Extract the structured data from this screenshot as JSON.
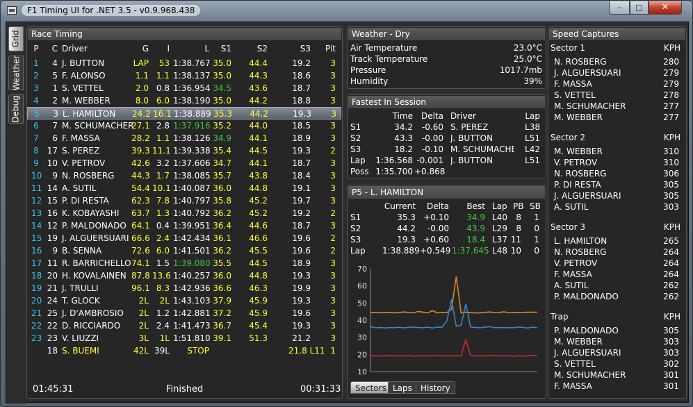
{
  "window": {
    "title": "F1 Timing UI for .NET 3.5 - v0.9.968.438",
    "min": "–",
    "max": "□",
    "close": "✕"
  },
  "side_tabs": [
    "Grid",
    "Weather",
    "Debug"
  ],
  "race": {
    "title": "Race Timing",
    "headers": [
      "P",
      "C",
      "Driver",
      "G",
      "I",
      "L",
      "S1",
      "S2",
      "S3",
      "Pit"
    ],
    "rows": [
      {
        "p": "1",
        "c": "4",
        "d": "J. BUTTON",
        "g": "LAP",
        "i": "53",
        "l": "1:38.767",
        "s1": "35.0",
        "s2": "44.4",
        "s3": "19.2",
        "pit": "3",
        "cols": {
          "p": "cyan",
          "d": "wht",
          "g": "yel",
          "i": "yel",
          "l": "wht",
          "s1": "yel",
          "s2": "yel",
          "s3": "wht",
          "pit": "yel"
        }
      },
      {
        "p": "2",
        "c": "5",
        "d": "F. ALONSO",
        "g": "1.1",
        "i": "1.1",
        "l": "1:38.137",
        "s1": "35.0",
        "s2": "44.3",
        "s3": "18.6",
        "pit": "3",
        "cols": {
          "p": "cyan",
          "d": "wht",
          "g": "yel",
          "i": "yel",
          "l": "wht",
          "s1": "yel",
          "s2": "yel",
          "s3": "wht",
          "pit": "yel"
        }
      },
      {
        "p": "3",
        "c": "1",
        "d": "S. VETTEL",
        "g": "2.0",
        "i": "0.8",
        "l": "1:36.954",
        "s1": "34.5",
        "s2": "43.6",
        "s3": "18.7",
        "pit": "3",
        "cols": {
          "p": "cyan",
          "d": "wht",
          "g": "yel",
          "i": "wht",
          "l": "wht",
          "s1": "grn",
          "s2": "yel",
          "s3": "wht",
          "pit": "yel"
        }
      },
      {
        "p": "4",
        "c": "2",
        "d": "M. WEBBER",
        "g": "8.0",
        "i": "6.0",
        "l": "1:38.190",
        "s1": "35.0",
        "s2": "44.2",
        "s3": "18.8",
        "pit": "3",
        "cols": {
          "p": "cyan",
          "d": "wht",
          "g": "yel",
          "i": "yel",
          "l": "wht",
          "s1": "yel",
          "s2": "yel",
          "s3": "wht",
          "pit": "yel"
        }
      },
      {
        "p": "5",
        "c": "3",
        "d": "L. HAMILTON",
        "g": "24.2",
        "i": "16.1",
        "l": "1:38.889",
        "s1": "35.3",
        "s2": "44.2",
        "s3": "19.3",
        "pit": "3",
        "sel": true,
        "cols": {
          "p": "cyan",
          "d": "wht",
          "g": "yel",
          "i": "yel",
          "l": "wht",
          "s1": "yel",
          "s2": "yel",
          "s3": "wht",
          "pit": "yel"
        }
      },
      {
        "p": "6",
        "c": "7",
        "d": "M. SCHUMACHER",
        "g": "27.1",
        "i": "2.8",
        "l": "1:37.916",
        "s1": "35.2",
        "s2": "44.0",
        "s3": "18.5",
        "pit": "3",
        "cols": {
          "p": "cyan",
          "d": "wht",
          "g": "yel",
          "i": "wht",
          "l": "grn",
          "s1": "yel",
          "s2": "yel",
          "s3": "wht",
          "pit": "yel"
        }
      },
      {
        "p": "7",
        "c": "6",
        "d": "F. MASSA",
        "g": "28.2",
        "i": "1.1",
        "l": "1:38.126",
        "s1": "34.9",
        "s2": "44.1",
        "s3": "18.9",
        "pit": "3",
        "cols": {
          "p": "cyan",
          "d": "wht",
          "g": "yel",
          "i": "yel",
          "l": "wht",
          "s1": "grn",
          "s2": "yel",
          "s3": "wht",
          "pit": "yel"
        }
      },
      {
        "p": "8",
        "c": "17",
        "d": "S. PEREZ",
        "g": "39.3",
        "i": "11.1",
        "l": "1:39.338",
        "s1": "35.4",
        "s2": "44.5",
        "s3": "19.3",
        "pit": "2",
        "cols": {
          "p": "cyan",
          "d": "wht",
          "g": "yel",
          "i": "yel",
          "l": "wht",
          "s1": "yel",
          "s2": "yel",
          "s3": "wht",
          "pit": "yel"
        }
      },
      {
        "p": "9",
        "c": "10",
        "d": "V. PETROV",
        "g": "42.6",
        "i": "3.2",
        "l": "1:37.606",
        "s1": "34.7",
        "s2": "44.1",
        "s3": "18.7",
        "pit": "3",
        "cols": {
          "p": "cyan",
          "d": "wht",
          "g": "yel",
          "i": "wht",
          "l": "wht",
          "s1": "yel",
          "s2": "yel",
          "s3": "wht",
          "pit": "yel"
        }
      },
      {
        "p": "10",
        "c": "9",
        "d": "N. ROSBERG",
        "g": "44.3",
        "i": "1.7",
        "l": "1:38.085",
        "s1": "35.7",
        "s2": "43.8",
        "s3": "18.4",
        "pit": "3",
        "cols": {
          "p": "cyan",
          "d": "wht",
          "g": "yel",
          "i": "yel",
          "l": "wht",
          "s1": "yel",
          "s2": "yel",
          "s3": "wht",
          "pit": "yel"
        }
      },
      {
        "p": "11",
        "c": "14",
        "d": "A. SUTIL",
        "g": "54.4",
        "i": "10.1",
        "l": "1:40.087",
        "s1": "36.0",
        "s2": "44.8",
        "s3": "19.1",
        "pit": "3",
        "cols": {
          "p": "cyan",
          "d": "wht",
          "g": "yel",
          "i": "yel",
          "l": "wht",
          "s1": "yel",
          "s2": "yel",
          "s3": "wht",
          "pit": "yel"
        }
      },
      {
        "p": "12",
        "c": "15",
        "d": "P. DI RESTA",
        "g": "62.3",
        "i": "7.8",
        "l": "1:40.797",
        "s1": "35.8",
        "s2": "45.2",
        "s3": "19.7",
        "pit": "3",
        "cols": {
          "p": "cyan",
          "d": "wht",
          "g": "yel",
          "i": "yel",
          "l": "wht",
          "s1": "yel",
          "s2": "yel",
          "s3": "wht",
          "pit": "yel"
        }
      },
      {
        "p": "13",
        "c": "16",
        "d": "K. KOBAYASHI",
        "g": "63.7",
        "i": "1.3",
        "l": "1:40.792",
        "s1": "36.2",
        "s2": "45.2",
        "s3": "19.2",
        "pit": "2",
        "cols": {
          "p": "cyan",
          "d": "wht",
          "g": "yel",
          "i": "yel",
          "l": "wht",
          "s1": "yel",
          "s2": "yel",
          "s3": "wht",
          "pit": "yel"
        }
      },
      {
        "p": "14",
        "c": "12",
        "d": "P. MALDONADO",
        "g": "64.1",
        "i": "0.4",
        "l": "1:39.951",
        "s1": "36.4",
        "s2": "44.6",
        "s3": "18.7",
        "pit": "3",
        "cols": {
          "p": "cyan",
          "d": "wht",
          "g": "yel",
          "i": "wht",
          "l": "wht",
          "s1": "yel",
          "s2": "yel",
          "s3": "wht",
          "pit": "yel"
        }
      },
      {
        "p": "15",
        "c": "19",
        "d": "J. ALGUERSUARI",
        "g": "66.6",
        "i": "2.4",
        "l": "1:42.434",
        "s1": "36.1",
        "s2": "46.6",
        "s3": "19.6",
        "pit": "2",
        "cols": {
          "p": "cyan",
          "d": "wht",
          "g": "yel",
          "i": "yel",
          "l": "wht",
          "s1": "yel",
          "s2": "yel",
          "s3": "wht",
          "pit": "yel"
        }
      },
      {
        "p": "16",
        "c": "9",
        "d": "B. SENNA",
        "g": "72.6",
        "i": "6.0",
        "l": "1:41.501",
        "s1": "36.2",
        "s2": "45.5",
        "s3": "19.6",
        "pit": "2",
        "cols": {
          "p": "cyan",
          "d": "wht",
          "g": "yel",
          "i": "yel",
          "l": "wht",
          "s1": "yel",
          "s2": "yel",
          "s3": "wht",
          "pit": "yel"
        }
      },
      {
        "p": "17",
        "c": "11",
        "d": "R. BARRICHELLO",
        "g": "74.1",
        "i": "1.5",
        "l": "1:39.080",
        "s1": "35.5",
        "s2": "44.5",
        "s3": "18.9",
        "pit": "3",
        "cols": {
          "p": "cyan",
          "d": "wht",
          "g": "yel",
          "i": "wht",
          "l": "grn",
          "s1": "yel",
          "s2": "yel",
          "s3": "wht",
          "pit": "yel"
        }
      },
      {
        "p": "18",
        "c": "20",
        "d": "H. KOVALAINEN",
        "g": "87.8",
        "i": "13.6",
        "l": "1:40.257",
        "s1": "36.0",
        "s2": "44.8",
        "s3": "19.3",
        "pit": "3",
        "cols": {
          "p": "cyan",
          "d": "wht",
          "g": "yel",
          "i": "yel",
          "l": "wht",
          "s1": "yel",
          "s2": "yel",
          "s3": "wht",
          "pit": "yel"
        }
      },
      {
        "p": "19",
        "c": "21",
        "d": "J. TRULLI",
        "g": "96.1",
        "i": "8.3",
        "l": "1:42.936",
        "s1": "36.6",
        "s2": "46.3",
        "s3": "19.9",
        "pit": "3",
        "cols": {
          "p": "cyan",
          "d": "wht",
          "g": "yel",
          "i": "yel",
          "l": "wht",
          "s1": "yel",
          "s2": "yel",
          "s3": "wht",
          "pit": "yel"
        }
      },
      {
        "p": "20",
        "c": "24",
        "d": "T. GLOCK",
        "g": "2L",
        "i": "2L",
        "l": "1:43.103",
        "s1": "37.9",
        "s2": "45.9",
        "s3": "19.3",
        "pit": "3",
        "cols": {
          "p": "cyan",
          "d": "wht",
          "g": "yel",
          "i": "yel",
          "l": "wht",
          "s1": "yel",
          "s2": "yel",
          "s3": "wht",
          "pit": "yel"
        }
      },
      {
        "p": "21",
        "c": "25",
        "d": "J. D'AMBROSIO",
        "g": "2L",
        "i": "1.2",
        "l": "1:42.881",
        "s1": "37.2",
        "s2": "45.9",
        "s3": "19.6",
        "pit": "3",
        "cols": {
          "p": "cyan",
          "d": "wht",
          "g": "yel",
          "i": "wht",
          "l": "wht",
          "s1": "yel",
          "s2": "yel",
          "s3": "wht",
          "pit": "yel"
        }
      },
      {
        "p": "22",
        "c": "22",
        "d": "D. RICCIARDO",
        "g": "2L",
        "i": "2.4",
        "l": "1:41.473",
        "s1": "36.7",
        "s2": "45.4",
        "s3": "19.3",
        "pit": "3",
        "cols": {
          "p": "cyan",
          "d": "wht",
          "g": "yel",
          "i": "wht",
          "l": "wht",
          "s1": "yel",
          "s2": "yel",
          "s3": "wht",
          "pit": "yel"
        }
      },
      {
        "p": "23",
        "c": "23",
        "d": "V. LIUZZI",
        "g": "3L",
        "i": "1L",
        "l": "1:51.810",
        "s1": "39.1",
        "s2": "51.3",
        "s3": "21.2",
        "pit": "3",
        "cols": {
          "p": "cyan",
          "d": "wht",
          "g": "yel",
          "i": "yel",
          "l": "wht",
          "s1": "yel",
          "s2": "yel",
          "s3": "wht",
          "pit": "yel"
        }
      },
      {
        "p": "",
        "c": "18",
        "d": "S. BUEMI",
        "g": "42L",
        "i": "39L",
        "l": "STOP",
        "s1": "",
        "s2": "",
        "s3": "21.8 L11",
        "pit": "1",
        "cols": {
          "p": "cyan",
          "d": "yel",
          "g": "yel",
          "i": "wht",
          "l": "yel",
          "s1": "yel",
          "s2": "yel",
          "s3": "yel",
          "pit": "yel"
        }
      }
    ],
    "footer": {
      "elapsed": "01:45:31",
      "status": "Finished",
      "remaining": "00:31:33"
    }
  },
  "weather": {
    "title": "Weather - Dry",
    "rows": [
      {
        "k": "Air Temperature",
        "v": "23.0°C"
      },
      {
        "k": "Track Temperature",
        "v": "25.0°C"
      },
      {
        "k": "Pressure",
        "v": "1017.7mb"
      },
      {
        "k": "Humidity",
        "v": "39%"
      }
    ]
  },
  "fastest": {
    "title": "Fastest In Session",
    "headers": [
      "Time",
      "Delta",
      "Driver",
      "Lap"
    ],
    "rows": [
      {
        "k": "S1",
        "t": "34.2",
        "d": "-0.60",
        "n": "S. PEREZ",
        "l": "L38"
      },
      {
        "k": "S2",
        "t": "43.3",
        "d": "-0.00",
        "n": "J. BUTTON",
        "l": "L51"
      },
      {
        "k": "S3",
        "t": "18.2",
        "d": "-0.10",
        "n": "M. SCHUMACHER",
        "l": "L42"
      },
      {
        "k": "Lap",
        "t": "1:36.568",
        "d": "-0.001",
        "n": "J. BUTTON",
        "l": "L51"
      },
      {
        "k": "Poss",
        "t": "1:35.700",
        "d": "+0.868",
        "n": "",
        "l": ""
      }
    ]
  },
  "driver": {
    "title": "P5 - L. HAMILTON",
    "headers": [
      "Current",
      "Delta",
      "Best",
      "Lap",
      "PB",
      "SB"
    ],
    "rows": [
      {
        "k": "S1",
        "c": "35.3",
        "d": "+0.10",
        "b": "34.9",
        "l": "L40",
        "pb": "8",
        "sb": "1"
      },
      {
        "k": "S2",
        "c": "44.2",
        "d": "-0.00",
        "b": "43.9",
        "l": "L29",
        "pb": "8",
        "sb": "0"
      },
      {
        "k": "S3",
        "c": "19.3",
        "d": "+0.60",
        "b": "18.4",
        "l": "L37",
        "pb": "11",
        "sb": "1"
      },
      {
        "k": "Lap",
        "c": "1:38.889",
        "d": "+0.549",
        "b": "1:37.645",
        "l": "L48",
        "pb": "10",
        "sb": "0"
      }
    ],
    "tabs": [
      "Sectors",
      "Laps",
      "History"
    ]
  },
  "chart_data": {
    "type": "line",
    "ylim": [
      10,
      70
    ],
    "yticks": [
      "70",
      "60",
      "50",
      "40",
      "30",
      "20",
      "10"
    ],
    "series": [
      {
        "color": "#d9862a",
        "values": [
          44.5,
          44.5,
          44.3,
          44.4,
          44.6,
          44.2,
          44.5,
          44.8,
          44.4,
          44.3,
          45.1,
          44.7,
          44.2,
          45.5,
          44.3,
          44.6,
          44.4,
          46.5,
          65.5,
          44.2,
          44.7,
          44.4,
          44.3,
          44.2,
          44.6,
          44.8,
          44.4,
          44.5,
          44.9,
          44.3,
          44.5,
          44.6,
          44.4,
          44.7,
          44.6,
          44.7
        ]
      },
      {
        "color": "#3a84c9",
        "values": [
          36.2,
          35.6,
          35.8,
          35.4,
          35.7,
          35.6,
          35.9,
          35.5,
          35.8,
          36.0,
          35.7,
          35.6,
          35.9,
          35.4,
          36.0,
          35.8,
          39.5,
          52.0,
          36.5,
          37.0,
          49.5,
          36.0,
          35.8,
          35.5,
          35.9,
          36.2,
          35.6,
          35.8,
          35.5,
          35.7,
          35.6,
          36.0,
          35.8,
          35.4,
          35.9,
          35.6
        ]
      },
      {
        "color": "#c03030",
        "values": [
          19.3,
          19.2,
          19.1,
          19.3,
          19.2,
          19.4,
          19.1,
          19.2,
          19.3,
          19.0,
          19.2,
          19.3,
          19.1,
          19.4,
          19.2,
          19.3,
          19.1,
          19.2,
          19.3,
          19.2,
          28.5,
          19.5,
          19.2,
          19.1,
          19.3,
          19.2,
          19.4,
          19.1,
          19.3,
          19.2,
          19.0,
          19.3,
          19.1,
          19.2,
          19.4,
          19.3
        ]
      }
    ]
  },
  "speed": {
    "title": "Speed Captures",
    "groups": [
      {
        "name": "Sector 1",
        "unit": "KPH",
        "rows": [
          {
            "n": "N. ROSBERG",
            "s": "280"
          },
          {
            "n": "J. ALGUERSUARI",
            "s": "279"
          },
          {
            "n": "F. MASSA",
            "s": "279"
          },
          {
            "n": "S. VETTEL",
            "s": "278"
          },
          {
            "n": "M. SCHUMACHER",
            "s": "277"
          },
          {
            "n": "M. WEBBER",
            "s": "277"
          }
        ]
      },
      {
        "name": "Sector 2",
        "unit": "KPH",
        "rows": [
          {
            "n": "M. WEBBER",
            "s": "310"
          },
          {
            "n": "V. PETROV",
            "s": "310"
          },
          {
            "n": "N. ROSBERG",
            "s": "306"
          },
          {
            "n": "P. DI RESTA",
            "s": "305"
          },
          {
            "n": "J. ALGUERSUARI",
            "s": "305"
          },
          {
            "n": "A. SUTIL",
            "s": "303"
          }
        ]
      },
      {
        "name": "Sector 3",
        "unit": "KPH",
        "rows": [
          {
            "n": "L. HAMILTON",
            "s": "265"
          },
          {
            "n": "N. ROSBERG",
            "s": "264"
          },
          {
            "n": "V. PETROV",
            "s": "264"
          },
          {
            "n": "F. MASSA",
            "s": "264"
          },
          {
            "n": "A. SUTIL",
            "s": "262"
          },
          {
            "n": "P. MALDONADO",
            "s": "262"
          }
        ]
      },
      {
        "name": "Trap",
        "unit": "KPH",
        "rows": [
          {
            "n": "P. MALDONADO",
            "s": "305"
          },
          {
            "n": "M. WEBBER",
            "s": "303"
          },
          {
            "n": "J. ALGUERSUARI",
            "s": "303"
          },
          {
            "n": "S. VETTEL",
            "s": "302"
          },
          {
            "n": "M. SCHUMACHER",
            "s": "301"
          },
          {
            "n": "F. MASSA",
            "s": "301"
          }
        ]
      }
    ]
  }
}
